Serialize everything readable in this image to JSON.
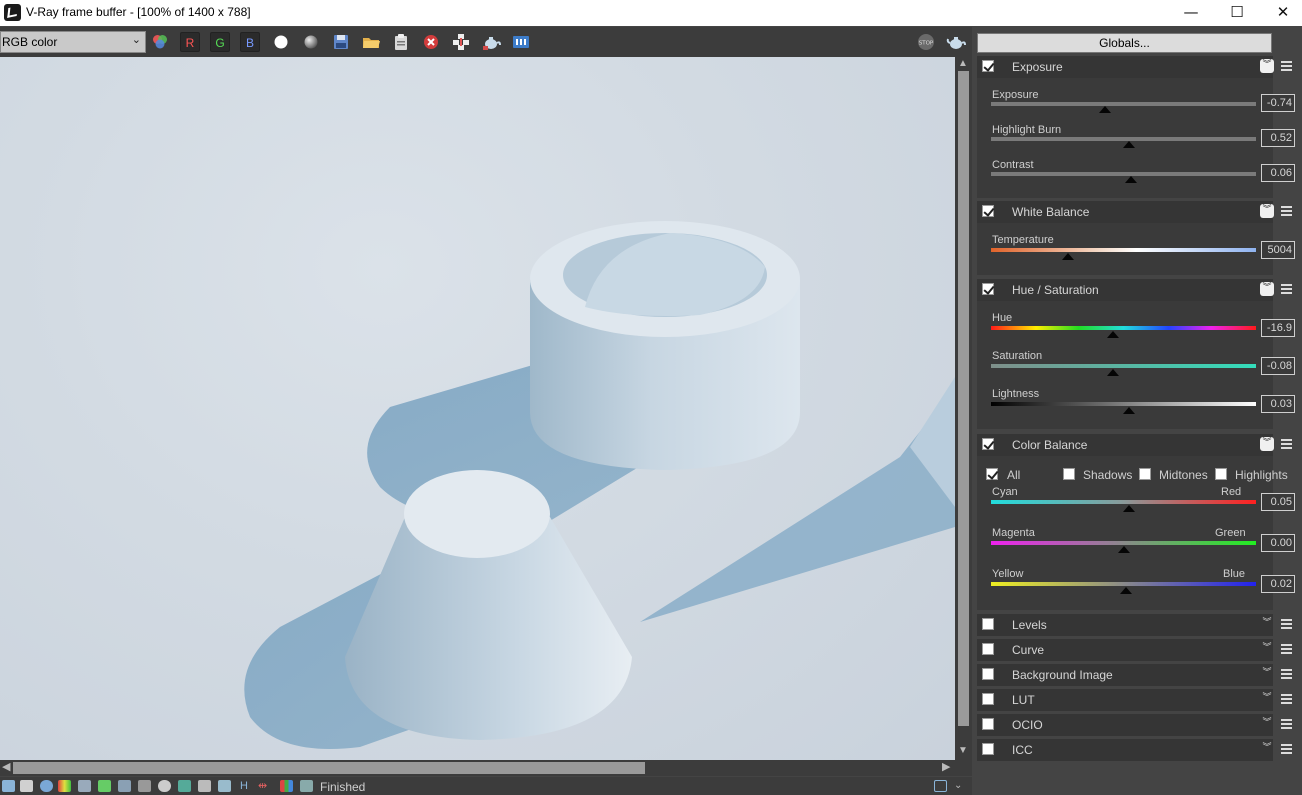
{
  "window": {
    "title": "V-Ray frame buffer - [100% of 1400 x 788]",
    "minimize": "—",
    "maximize": "☐",
    "close": "✕"
  },
  "toolbar": {
    "channel": "RGB color",
    "r_label": "R",
    "g_label": "G",
    "b_label": "B",
    "icons": [
      "color-channels-icon",
      "white-dot-icon",
      "sphere-icon",
      "save-icon",
      "open-folder-icon",
      "clipboard-icon",
      "clear-icon",
      "region-icon",
      "teapot-icon",
      "history-icon",
      "stop-icon",
      "render-teapot-icon"
    ]
  },
  "status": {
    "text": "Finished"
  },
  "panel": {
    "globals_label": "Globals...",
    "exposure": {
      "title": "Exposure",
      "enabled": true,
      "sliders": [
        {
          "label": "Exposure",
          "value": "-0.74",
          "pos": 0.43
        },
        {
          "label": "Highlight Burn",
          "value": "0.52",
          "pos": 0.52
        },
        {
          "label": "Contrast",
          "value": "0.06",
          "pos": 0.53
        }
      ]
    },
    "white_balance": {
      "title": "White Balance",
      "enabled": true,
      "sliders": [
        {
          "label": "Temperature",
          "value": "5004",
          "pos": 0.29
        }
      ]
    },
    "hue_saturation": {
      "title": "Hue / Saturation",
      "enabled": true,
      "sliders": [
        {
          "label": "Hue",
          "value": "-16.9",
          "pos": 0.46
        },
        {
          "label": "Saturation",
          "value": "-0.08",
          "pos": 0.46
        },
        {
          "label": "Lightness",
          "value": "0.03",
          "pos": 0.52
        }
      ]
    },
    "color_balance": {
      "title": "Color Balance",
      "enabled": true,
      "options": [
        {
          "label": "All",
          "checked": true
        },
        {
          "label": "Shadows",
          "checked": false
        },
        {
          "label": "Midtones",
          "checked": false
        },
        {
          "label": "Highlights",
          "checked": false
        }
      ],
      "sliders": [
        {
          "left": "Cyan",
          "right": "Red",
          "value": "0.05",
          "pos": 0.52
        },
        {
          "left": "Magenta",
          "right": "Green",
          "value": "0.00",
          "pos": 0.5
        },
        {
          "left": "Yellow",
          "right": "Blue",
          "value": "0.02",
          "pos": 0.51
        }
      ]
    },
    "collapsed_sections": [
      "Levels",
      "Curve",
      "Background Image",
      "LUT",
      "OCIO",
      "ICC"
    ]
  }
}
